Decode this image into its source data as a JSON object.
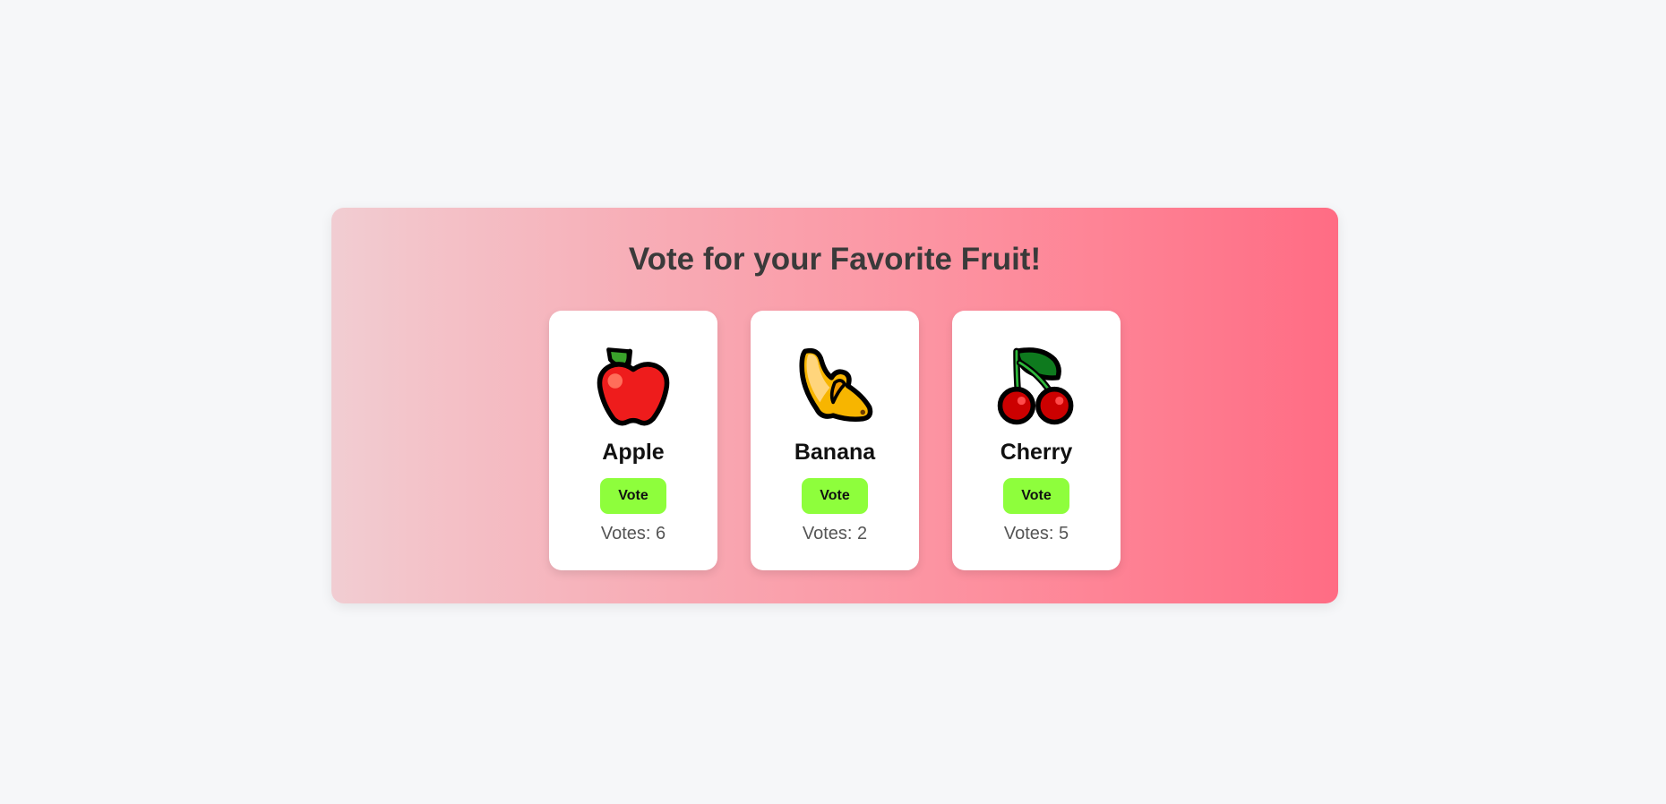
{
  "page": {
    "title": "Vote for your Favorite Fruit!"
  },
  "fruits": [
    {
      "name": "Apple",
      "vote_label": "Vote",
      "votes_text": "Votes: 6",
      "votes": 6,
      "icon": "apple-icon"
    },
    {
      "name": "Banana",
      "vote_label": "Vote",
      "votes_text": "Votes: 2",
      "votes": 2,
      "icon": "banana-icon"
    },
    {
      "name": "Cherry",
      "vote_label": "Vote",
      "votes_text": "Votes: 5",
      "votes": 5,
      "icon": "cherry-icon"
    }
  ],
  "colors": {
    "button": "#8efe3c",
    "title": "#3a3a3a",
    "panel_gradient_start": "#f1cdd2",
    "panel_gradient_end": "#ff6c84"
  }
}
